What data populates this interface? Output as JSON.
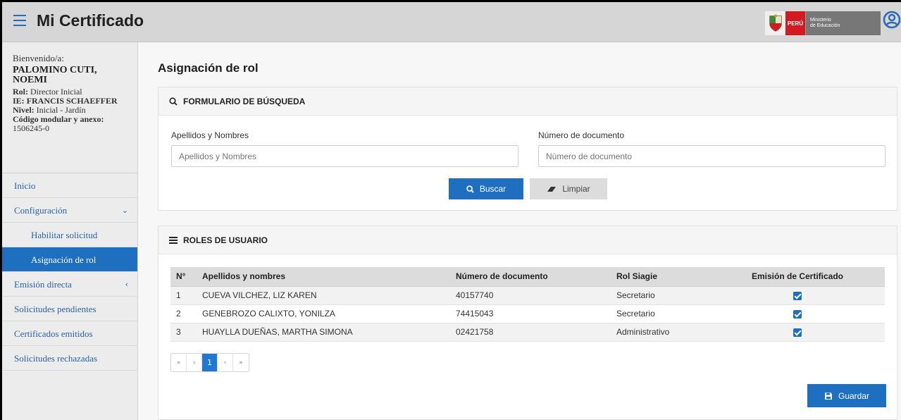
{
  "header": {
    "title": "Mi Certificado",
    "brand_peru": "PERÚ",
    "brand_line1": "Ministerio",
    "brand_line2": "de Educación"
  },
  "profile": {
    "welcome": "Bienvenido/a:",
    "name": "PALOMINO CUTI, NOEMI",
    "rol_label": "Rol:",
    "rol_value": "Director Inicial",
    "ie_label": "IE:",
    "ie_value": "FRANCIS SCHAEFFER",
    "nivel_label": "Nivel:",
    "nivel_value": "Inicial - Jardín",
    "codigo_label": "Código modular y anexo:",
    "codigo_value": "1506245-0"
  },
  "sidebar": {
    "items": [
      {
        "label": "Inicio"
      },
      {
        "label": "Configuración"
      },
      {
        "label": "Habilitar solicitud"
      },
      {
        "label": "Asignación de rol"
      },
      {
        "label": "Emisión directa"
      },
      {
        "label": "Solicitudes pendientes"
      },
      {
        "label": "Certificados emitidos"
      },
      {
        "label": "Solicitudes rechazadas"
      }
    ]
  },
  "page": {
    "title": "Asignación de rol"
  },
  "search": {
    "heading": "FORMULARIO DE BÚSQUEDA",
    "name_label": "Apellidos y Nombres",
    "name_placeholder": "Apellidos y Nombres",
    "doc_label": "Número de documento",
    "doc_placeholder": "Número de documento",
    "search_button": "Buscar",
    "clear_button": "Limpiar"
  },
  "roles": {
    "heading": "ROLES DE USUARIO",
    "columns": [
      "N°",
      "Apellidos y nombres",
      "Número de documento",
      "Rol Siagie",
      "Emisión de Certificado"
    ],
    "rows": [
      {
        "n": "1",
        "name": "CUEVA VILCHEZ, LIZ KAREN",
        "doc": "40157740",
        "rol": "Secretario",
        "emision": true
      },
      {
        "n": "2",
        "name": "GENEBROZO CALIXTO, YONILZA",
        "doc": "74415043",
        "rol": "Secretario",
        "emision": true
      },
      {
        "n": "3",
        "name": "HUAYLLA DUEÑAS, MARTHA SIMONA",
        "doc": "02421758",
        "rol": "Administrativo",
        "emision": true
      }
    ],
    "pagination": {
      "first": "«",
      "prev": "‹",
      "current": "1",
      "next": "›",
      "last": "»"
    },
    "save_button": "Guardar"
  },
  "colors": {
    "primary": "#1f6fc0",
    "header_bg": "#d6d6d6",
    "sidebar_bg": "#ececec",
    "peru_red": "#d11a22"
  }
}
